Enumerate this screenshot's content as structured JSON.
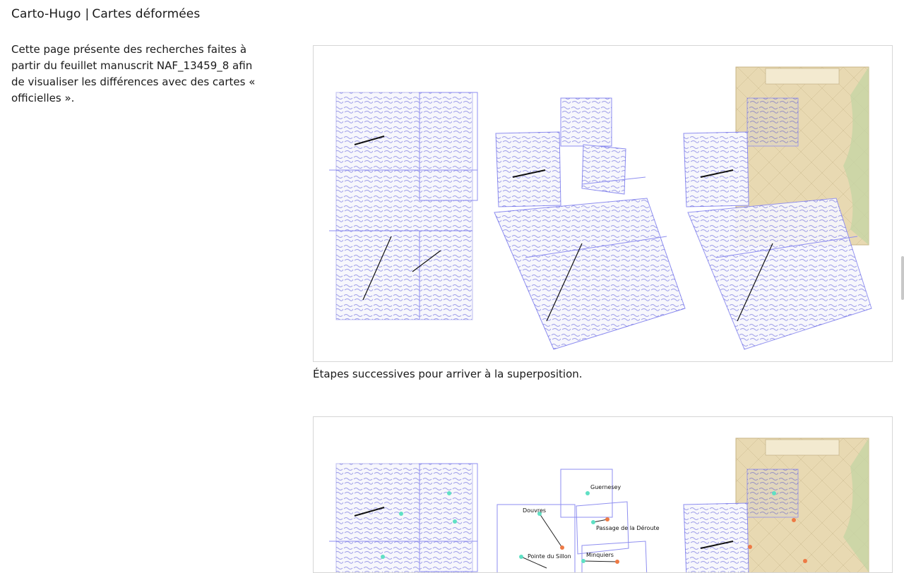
{
  "header": {
    "brand": "Carto-Hugo",
    "separator": "|",
    "page_title": "Cartes déformées"
  },
  "intro": {
    "text": "Cette page présente des recherches faites à partir du feuillet manuscrit NAF_13459_8 afin de visualiser les différences avec des cartes « officielles »."
  },
  "figures": [
    {
      "caption": "Étapes successives pour arriver à la superposition.",
      "panels": [
        "manuscript-original",
        "manuscript-deformed",
        "manuscript-over-map"
      ]
    },
    {
      "caption": "",
      "labels": [
        "Guernesey",
        "Douvres",
        "Passage de la Déroute",
        "Pointe du Sillon",
        "Minquiers"
      ]
    }
  ],
  "colors": {
    "ink": "#2a2ad0",
    "grid_lines": "#8e8ef0",
    "map_paper": "#e8d9b2",
    "origin_point": "#5fe0c4",
    "target_point": "#ee7a45"
  }
}
